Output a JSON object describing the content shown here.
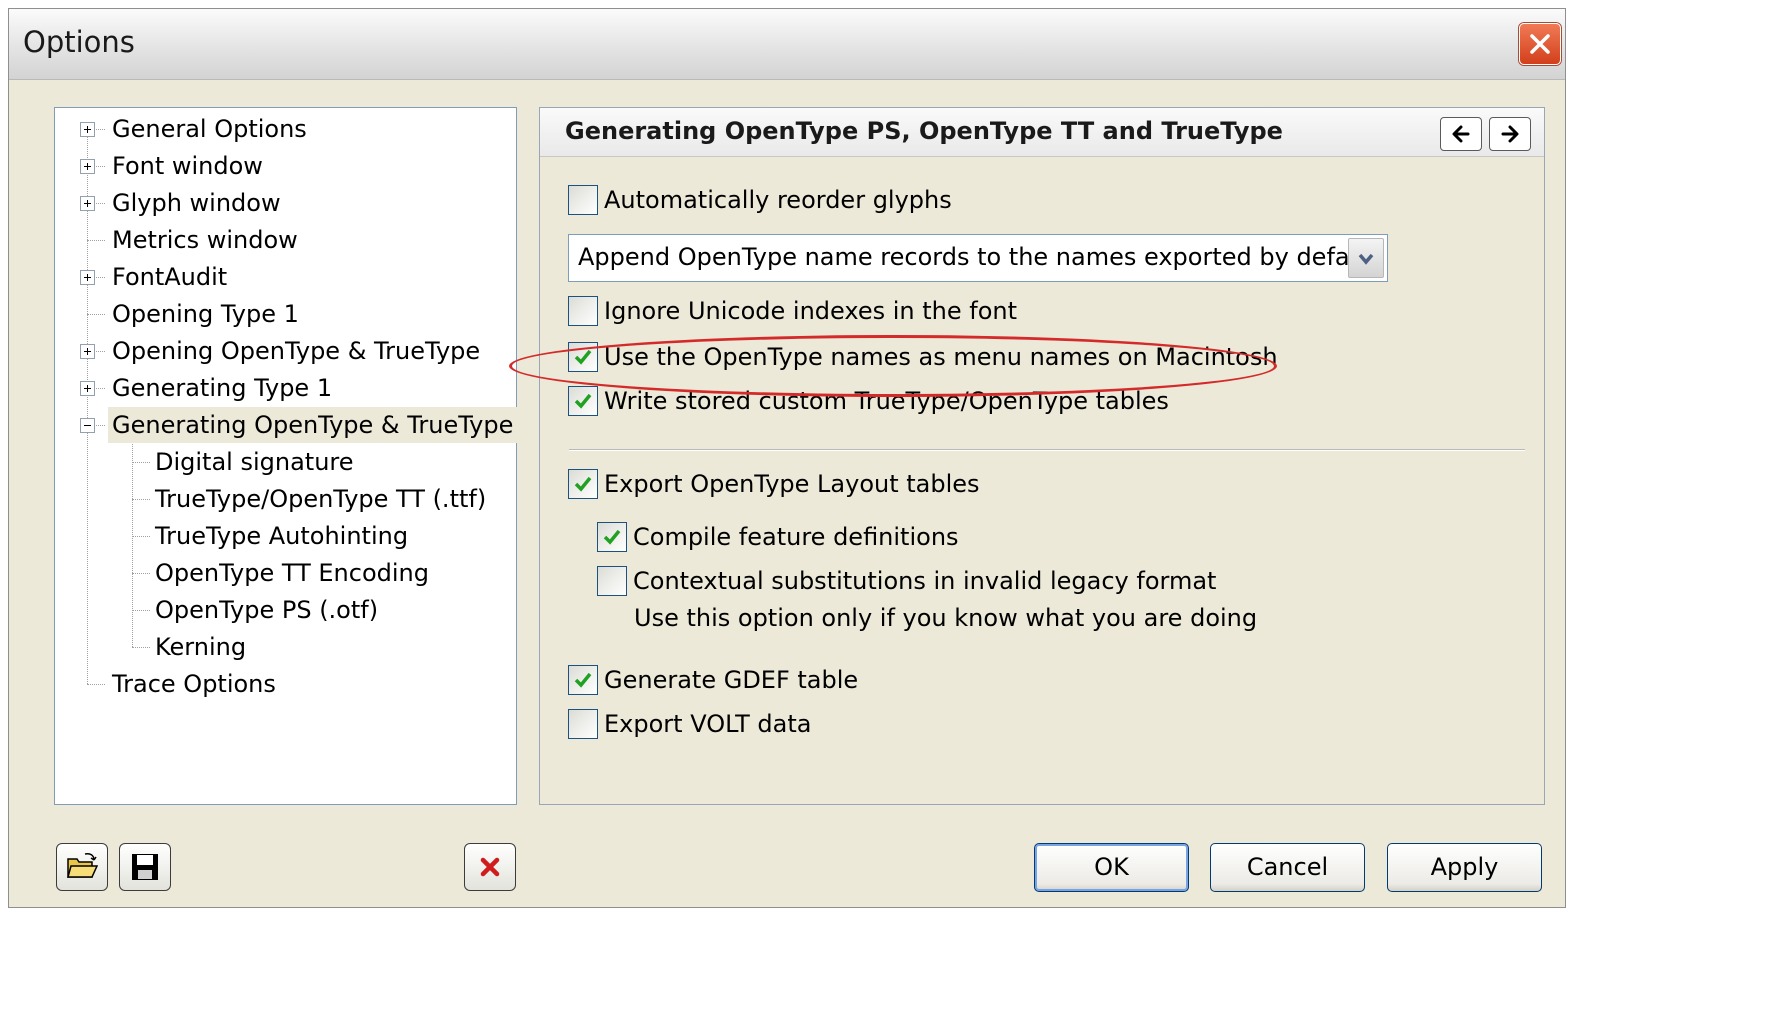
{
  "window": {
    "title": "Options"
  },
  "tree": {
    "items": [
      {
        "label": "General Options",
        "expander": "plus"
      },
      {
        "label": "Font window",
        "expander": "plus"
      },
      {
        "label": "Glyph window",
        "expander": "plus"
      },
      {
        "label": "Metrics window",
        "expander": "none"
      },
      {
        "label": "FontAudit",
        "expander": "plus"
      },
      {
        "label": "Opening Type 1",
        "expander": "none"
      },
      {
        "label": "Opening OpenType & TrueType",
        "expander": "plus"
      },
      {
        "label": "Generating Type 1",
        "expander": "plus"
      },
      {
        "label": "Generating OpenType & TrueType",
        "expander": "minus",
        "selected": true
      },
      {
        "label": "Digital signature",
        "expander": "none",
        "child": true
      },
      {
        "label": "TrueType/OpenType TT (.ttf)",
        "expander": "none",
        "child": true
      },
      {
        "label": "TrueType Autohinting",
        "expander": "none",
        "child": true
      },
      {
        "label": "OpenType TT Encoding",
        "expander": "none",
        "child": true
      },
      {
        "label": "OpenType PS (.otf)",
        "expander": "none",
        "child": true
      },
      {
        "label": "Kerning",
        "expander": "none",
        "child": true
      },
      {
        "label": "Trace Options",
        "expander": "none"
      }
    ]
  },
  "panel": {
    "title": "Generating OpenType PS, OpenType TT and TrueType",
    "nav_prev_icon": "arrow-left-icon",
    "nav_next_icon": "arrow-right-icon",
    "options": {
      "reorder_glyphs": {
        "label": "Automatically reorder glyphs",
        "checked": false
      },
      "name_records": {
        "value": "Append OpenType name records to the names exported by default"
      },
      "ignore_unicode": {
        "label": "Ignore Unicode indexes in the font",
        "checked": false
      },
      "mac_menu_names": {
        "label": "Use the OpenType names as menu names on Macintosh",
        "checked": true
      },
      "custom_tables": {
        "label": "Write stored custom TrueType/OpenType tables",
        "checked": true
      },
      "export_layout": {
        "label": "Export OpenType Layout tables",
        "checked": true
      },
      "compile_features": {
        "label": "Compile feature definitions",
        "checked": true
      },
      "legacy_format": {
        "label": "Contextual substitutions in invalid legacy format",
        "checked": false
      },
      "legacy_note": "Use this option only if you know what you are doing",
      "gdef": {
        "label": "Generate GDEF table",
        "checked": true
      },
      "volt": {
        "label": "Export VOLT data",
        "checked": false
      }
    },
    "highlight_color": "#d42a2a"
  },
  "footer": {
    "open_icon": "folder-open-icon",
    "save_icon": "floppy-disk-icon",
    "delete_icon": "red-x-icon",
    "ok_label": "OK",
    "cancel_label": "Cancel",
    "apply_label": "Apply"
  }
}
